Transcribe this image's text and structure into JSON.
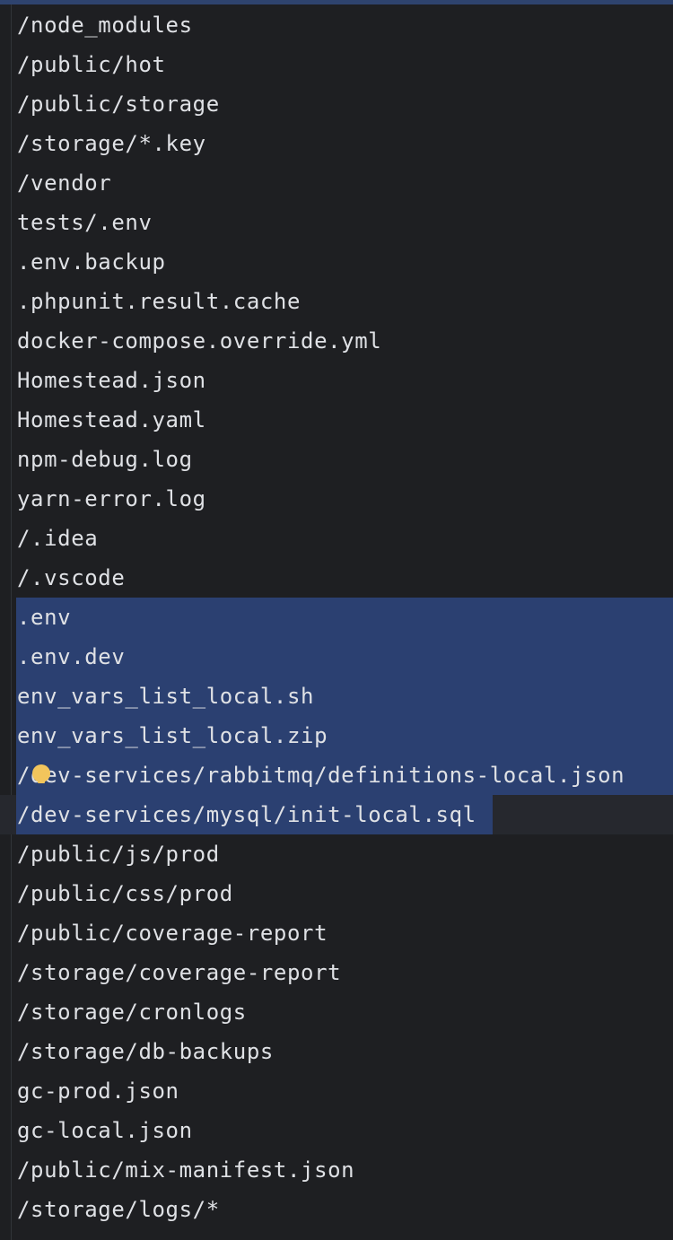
{
  "colors": {
    "background": "#1e1f22",
    "text": "#dfe1e5",
    "selection": "#2b4071",
    "caret_line": "#26282e",
    "intention_bulb": "#f2c55c"
  },
  "editor": {
    "lines": [
      "/node_modules",
      "/public/hot",
      "/public/storage",
      "/storage/*.key",
      "/vendor",
      "tests/.env",
      ".env.backup",
      ".phpunit.result.cache",
      "docker-compose.override.yml",
      "Homestead.json",
      "Homestead.yaml",
      "npm-debug.log",
      "yarn-error.log",
      "/.idea",
      "/.vscode",
      ".env",
      ".env.dev",
      "env_vars_list_local.sh",
      "env_vars_list_local.zip",
      "/dev-services/rabbitmq/definitions-local.json",
      "/dev-services/mysql/init-local.sql",
      "/public/js/prod",
      "/public/css/prod",
      "/public/coverage-report",
      "/storage/coverage-report",
      "/storage/cronlogs",
      "/storage/db-backups",
      "gc-prod.json",
      "gc-local.json",
      "/public/mix-manifest.json",
      "/storage/logs/*"
    ],
    "selected_full_lines": [
      15,
      16,
      17,
      18,
      19
    ],
    "selected_partial_line": 20,
    "caret_line": 20,
    "bulb_line": 19,
    "bulb_icon": "intention-bulb-icon"
  }
}
